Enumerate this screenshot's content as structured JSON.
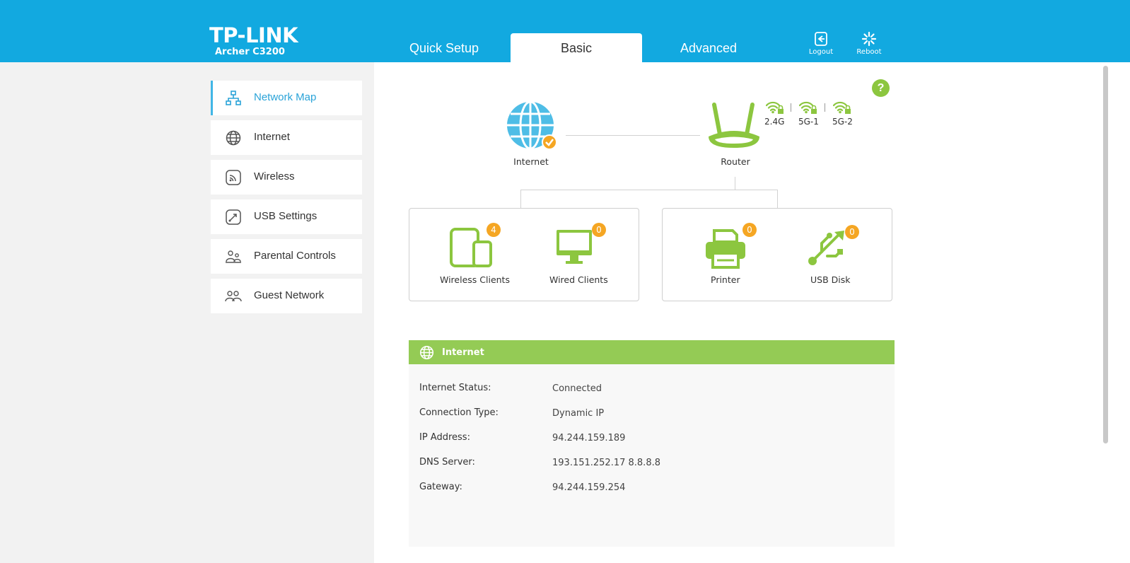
{
  "header": {
    "brand": "TP-LINK",
    "model": "Archer C3200",
    "tabs": [
      {
        "label": "Quick Setup"
      },
      {
        "label": "Basic",
        "active": true
      },
      {
        "label": "Advanced"
      }
    ],
    "logout_label": "Logout",
    "reboot_label": "Reboot"
  },
  "sidebar": {
    "items": [
      {
        "label": "Network Map",
        "icon": "network-map-icon",
        "active": true
      },
      {
        "label": "Internet",
        "icon": "globe-icon"
      },
      {
        "label": "Wireless",
        "icon": "wireless-icon"
      },
      {
        "label": "USB Settings",
        "icon": "usb-settings-icon"
      },
      {
        "label": "Parental Controls",
        "icon": "parental-controls-icon"
      },
      {
        "label": "Guest Network",
        "icon": "guest-network-icon"
      }
    ]
  },
  "map": {
    "internet_label": "Internet",
    "router_label": "Router",
    "wifi_bands": [
      "2.4G",
      "5G-1",
      "5G-2"
    ],
    "devices": [
      {
        "label": "Wireless Clients",
        "count": "4"
      },
      {
        "label": "Wired Clients",
        "count": "0"
      },
      {
        "label": "Printer",
        "count": "0"
      },
      {
        "label": "USB Disk",
        "count": "0"
      }
    ]
  },
  "panel": {
    "title": "Internet",
    "rows": [
      {
        "label": "Internet Status:",
        "value": "Connected"
      },
      {
        "label": "Connection Type:",
        "value": "Dynamic IP"
      },
      {
        "label": "IP Address:",
        "value": "94.244.159.189"
      },
      {
        "label": "DNS Server:",
        "value": "193.151.252.17 8.8.8.8"
      },
      {
        "label": "Gateway:",
        "value": "94.244.159.254"
      }
    ]
  },
  "colors": {
    "header_blue": "#12a9e0",
    "accent_green": "#8cc63f",
    "badge_orange": "#f5a623",
    "internet_blue": "#4ebde6"
  }
}
